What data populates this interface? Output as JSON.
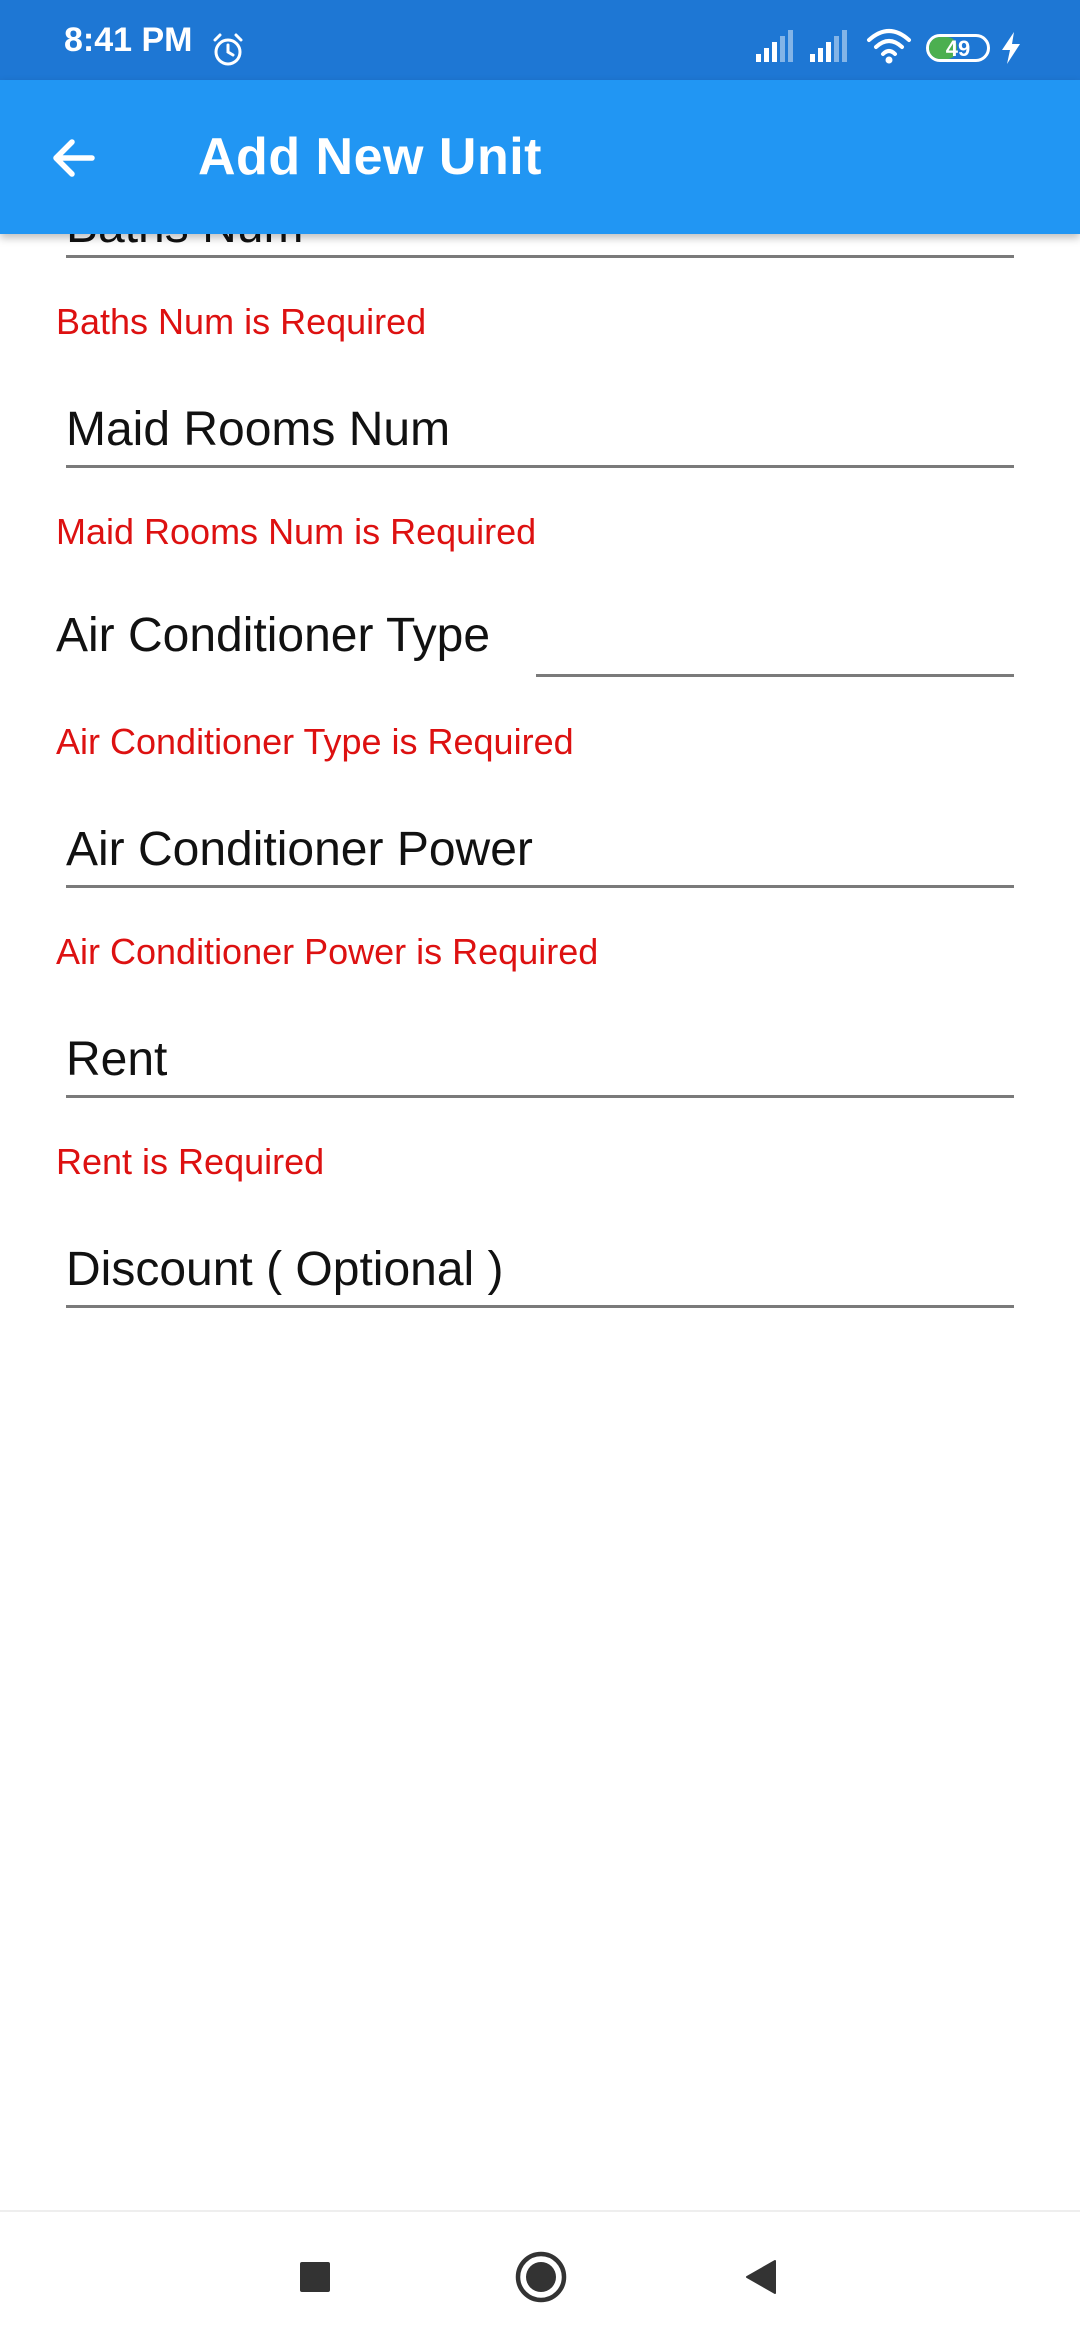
{
  "status_bar": {
    "time": "8:41 PM",
    "battery_level": "49",
    "battery_fraction": 0.49,
    "icons": [
      "alarm-icon",
      "signal-icon",
      "signal-icon",
      "wifi-icon",
      "battery-icon",
      "charging-icon"
    ]
  },
  "app_bar": {
    "title": "Add New Unit",
    "back_icon": "arrow-left-icon",
    "background": "#2196f3"
  },
  "form": {
    "baths_num_partial": "Baths Num",
    "baths_num_error": "Baths Num is Required",
    "maid_rooms_placeholder": "Maid Rooms Num",
    "maid_rooms_error": "Maid Rooms Num is Required",
    "ac_type_label": "Air Conditioner Type",
    "ac_type_error": "Air Conditioner Type is Required",
    "ac_power_placeholder": "Air Conditioner Power",
    "ac_power_error": "Air Conditioner Power is Required",
    "rent_placeholder": "Rent",
    "rent_error": "Rent is Required",
    "discount_placeholder": "Discount ( Optional )",
    "error_color": "#dd1111"
  },
  "nav_bar": {
    "icons": [
      "square-recents-icon",
      "circle-home-icon",
      "triangle-back-icon"
    ]
  }
}
